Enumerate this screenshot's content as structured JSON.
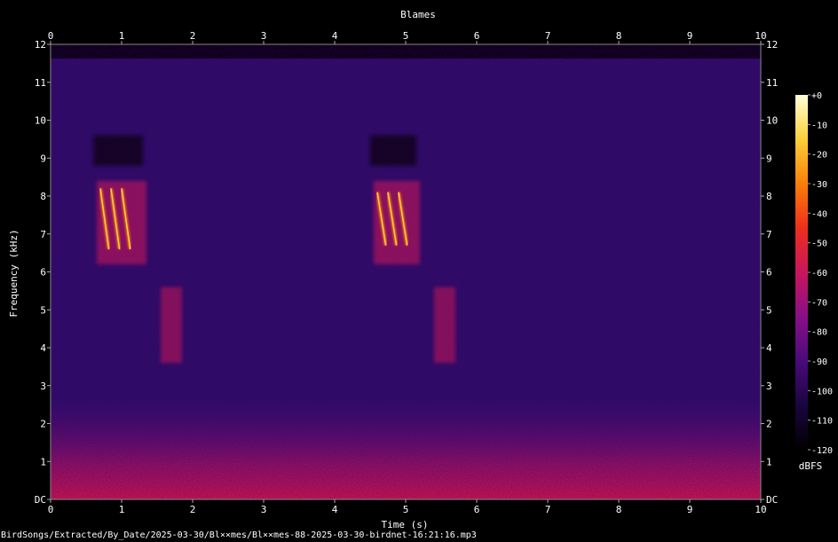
{
  "chart_data": {
    "type": "heatmap",
    "title": "Blames",
    "xlabel": "Time (s)",
    "ylabel": "Frequency (kHz)",
    "xlim": [
      0,
      10
    ],
    "ylim": [
      0,
      12
    ],
    "x_ticks": [
      "0",
      "1",
      "2",
      "3",
      "4",
      "5",
      "6",
      "7",
      "8",
      "9",
      "10"
    ],
    "y_ticks": [
      "DC",
      "1",
      "2",
      "3",
      "4",
      "5",
      "6",
      "7",
      "8",
      "9",
      "10",
      "11",
      "12"
    ],
    "colorbar": {
      "label": "dBFS",
      "range": [
        -120,
        0
      ],
      "ticks": [
        "+0",
        "-10",
        "-20",
        "-30",
        "-40",
        "-50",
        "-60",
        "-70",
        "-80",
        "-90",
        "-100",
        "-110",
        "-120"
      ],
      "colors": [
        "#000000",
        "#1a0540",
        "#4a0a7c",
        "#8a0f86",
        "#c8165c",
        "#ef2e1c",
        "#f97f0a",
        "#fbd038",
        "#ffffd8"
      ]
    },
    "events": [
      {
        "t_start": 0.7,
        "t_end": 1.2,
        "f_high_khz": 8.2,
        "f_low_khz": 6.3,
        "level_dbfs": -25
      },
      {
        "t_start": 4.6,
        "t_end": 5.05,
        "f_high_khz": 8.1,
        "f_low_khz": 6.4,
        "level_dbfs": -25
      }
    ],
    "noise_floor_khz": 2
  },
  "footer": {
    "path": "BirdSongs/Extracted/By_Date/2025-03-30/Bl××mes/Bl××mes-88-2025-03-30-birdnet-16:21:16.mp3"
  }
}
